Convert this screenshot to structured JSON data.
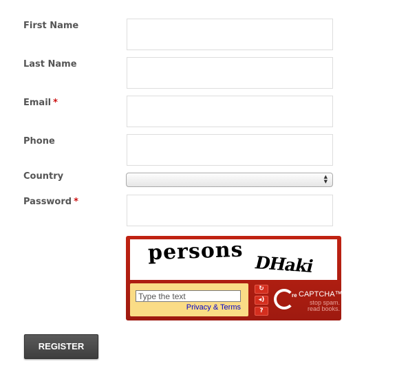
{
  "form": {
    "first_name": {
      "label": "First Name",
      "value": "",
      "required": false
    },
    "last_name": {
      "label": "Last Name",
      "value": "",
      "required": false
    },
    "email": {
      "label": "Email",
      "value": "",
      "required": true
    },
    "phone": {
      "label": "Phone",
      "value": "",
      "required": false
    },
    "country": {
      "label": "Country",
      "selected": "",
      "required": false
    },
    "password": {
      "label": "Password",
      "value": "",
      "required": true
    },
    "required_marker": "*"
  },
  "captcha": {
    "word1": "persons",
    "word2": "DHaki",
    "placeholder": "Type the text",
    "privacy_link": "Privacy & Terms",
    "brand_prefix": "re",
    "brand_name": "CAPTCHA™",
    "tagline_line1": "stop spam.",
    "tagline_line2": "read books.",
    "refresh_icon": "↻",
    "audio_icon": "◂)",
    "help_icon": "?"
  },
  "actions": {
    "register_label": "REGISTER"
  },
  "colors": {
    "label": "#555555",
    "required": "#cc1111",
    "captcha_frame": "#b31e12",
    "captcha_panel": "#fadc86",
    "button": "#4a4a4a"
  }
}
